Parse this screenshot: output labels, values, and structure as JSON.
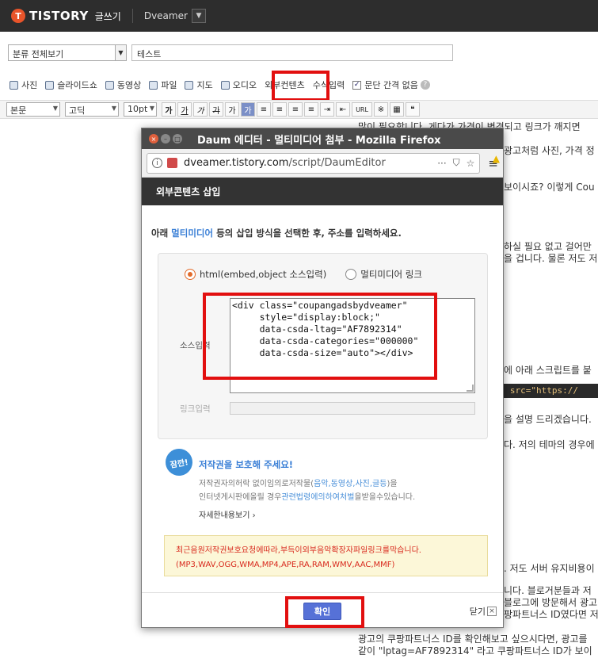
{
  "topbar": {
    "logo_mark": "T",
    "logo_text": "TISTORY",
    "write_label": "글쓰기",
    "blog_name": "Dveamer"
  },
  "category": {
    "selected": "분류 전체보기"
  },
  "title_field": {
    "value": "테스트"
  },
  "attach_bar": {
    "items": [
      "사진",
      "슬라이드쇼",
      "동영상",
      "파일",
      "지도",
      "오디오",
      "외부컨텐츠",
      "수식입력"
    ],
    "paragraph_label": "문단 간격 없음",
    "help": "?"
  },
  "format_bar": {
    "style": "본문",
    "font": "고딕",
    "size": "10pt",
    "buttons": [
      "가",
      "가",
      "가",
      "가",
      "가",
      "가",
      "≡",
      "≡",
      "≡",
      "≡",
      "⇥",
      "⇤",
      "URL",
      "※"
    ]
  },
  "background_text": {
    "lines": [
      "많이 필요합니다. 게다가 가격이 변경되고 링크가 깨지면",
      "광고처럼 사진, 가격 정",
      "보이시죠? 이렇게 Cou",
      "하실 필요 없고 걸어만",
      "을 겁니다. 물론 저도 저",
      "에 아래 스크립트를 붙",
      "을 설명 드리겠습니다.",
      "다. 저의 테마의 경우에",
      ". 저도 서버 유지비용이",
      "니다. 블로거분들과 저",
      "블로그에 방문해서 광고",
      "팡파트너스 ID였다면 저",
      "광고의 쿠팡파트너스 ID를 확인해보고 싶으시다면, 광고를",
      "같이 \"lptag=AF7892314\" 라고 쿠팡파트너스 ID가 보이"
    ],
    "code_snippet": "c\" src=\"https://"
  },
  "popup": {
    "window_title": "Daum 에디터 - 멀티미디어 첨부 - Mozilla Firefox",
    "url_domain": "dveamer.tistory.com",
    "url_path": "/script/DaumEditor",
    "url_more": "···",
    "section_title": "외부콘텐츠 삽입",
    "instruction_pre": "아래 ",
    "instruction_hl": "멀티미디어",
    "instruction_post": " 등의 삽입 방식을 선택한 후, 주소를 입력하세요.",
    "radio_html": "html(embed,object 소스입력)",
    "radio_link": "멀티미디어 링크",
    "source_label": "소스입력",
    "source_value": "<div class=\"coupangadsbydveamer\"\n     style=\"display:block;\"\n     data-csda-ltag=\"AF7892314\"\n     data-csda-categories=\"000000\"\n     data-csda-size=\"auto\"></div>",
    "link_label": "링크입력",
    "badge": "잠깐!",
    "copyright_title": "저작권을 보호해 주세요!",
    "copyright_line1_a": "저작권자의허락 없이임의로저작물(",
    "copyright_line1_hl": "음악,동영상,사진,글등",
    "copyright_line1_b": ")을",
    "copyright_line2_a": "인터넷게시판에올릴 경우",
    "copyright_line2_hl": "관련법령에의하여처벌",
    "copyright_line2_b": "을받을수있습니다.",
    "copyright_more": "자세한내용보기",
    "music_line1": "최근음원저작권보호요청에따라,부득이외부음악확장자파일링크를막습니다.",
    "music_line2": "(MP3,WAV,OGG,WMA,MP4,APE,RA,RAM,WMV,AAC,MMF)",
    "ok_label": "확인",
    "close_label": "닫기"
  },
  "colors": {
    "highlight_red": "#e20f0f",
    "accent_blue": "#3a7fd6",
    "ok_button": "#5671d7",
    "notice_red": "#d8291d"
  }
}
